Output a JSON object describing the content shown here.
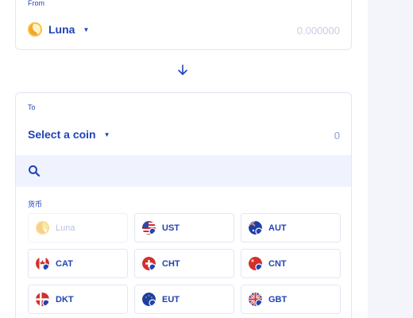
{
  "from": {
    "label": "From",
    "coin": "Luna",
    "amount_placeholder": "0.000000"
  },
  "to": {
    "label": "To",
    "coin": "Select a coin",
    "amount": "0"
  },
  "search": {
    "placeholder": ""
  },
  "currency_section": {
    "title": "货币",
    "coins": [
      {
        "name": "Luna",
        "icon": "luna-icon",
        "disabled": true
      },
      {
        "name": "UST",
        "icon": "us-flag-icon",
        "disabled": false
      },
      {
        "name": "AUT",
        "icon": "australia-flag-icon",
        "disabled": false
      },
      {
        "name": "CAT",
        "icon": "canada-flag-icon",
        "disabled": false
      },
      {
        "name": "CHT",
        "icon": "switzerland-flag-icon",
        "disabled": false
      },
      {
        "name": "CNT",
        "icon": "china-flag-icon",
        "disabled": false
      },
      {
        "name": "DKT",
        "icon": "denmark-flag-icon",
        "disabled": false
      },
      {
        "name": "EUT",
        "icon": "eu-flag-icon",
        "disabled": false
      },
      {
        "name": "GBT",
        "icon": "uk-flag-icon",
        "disabled": false
      }
    ]
  },
  "colors": {
    "accent": "#2043b5",
    "border": "#e3e7f4",
    "search_bg": "#f0f3fd",
    "placeholder": "#c9cfe4"
  }
}
